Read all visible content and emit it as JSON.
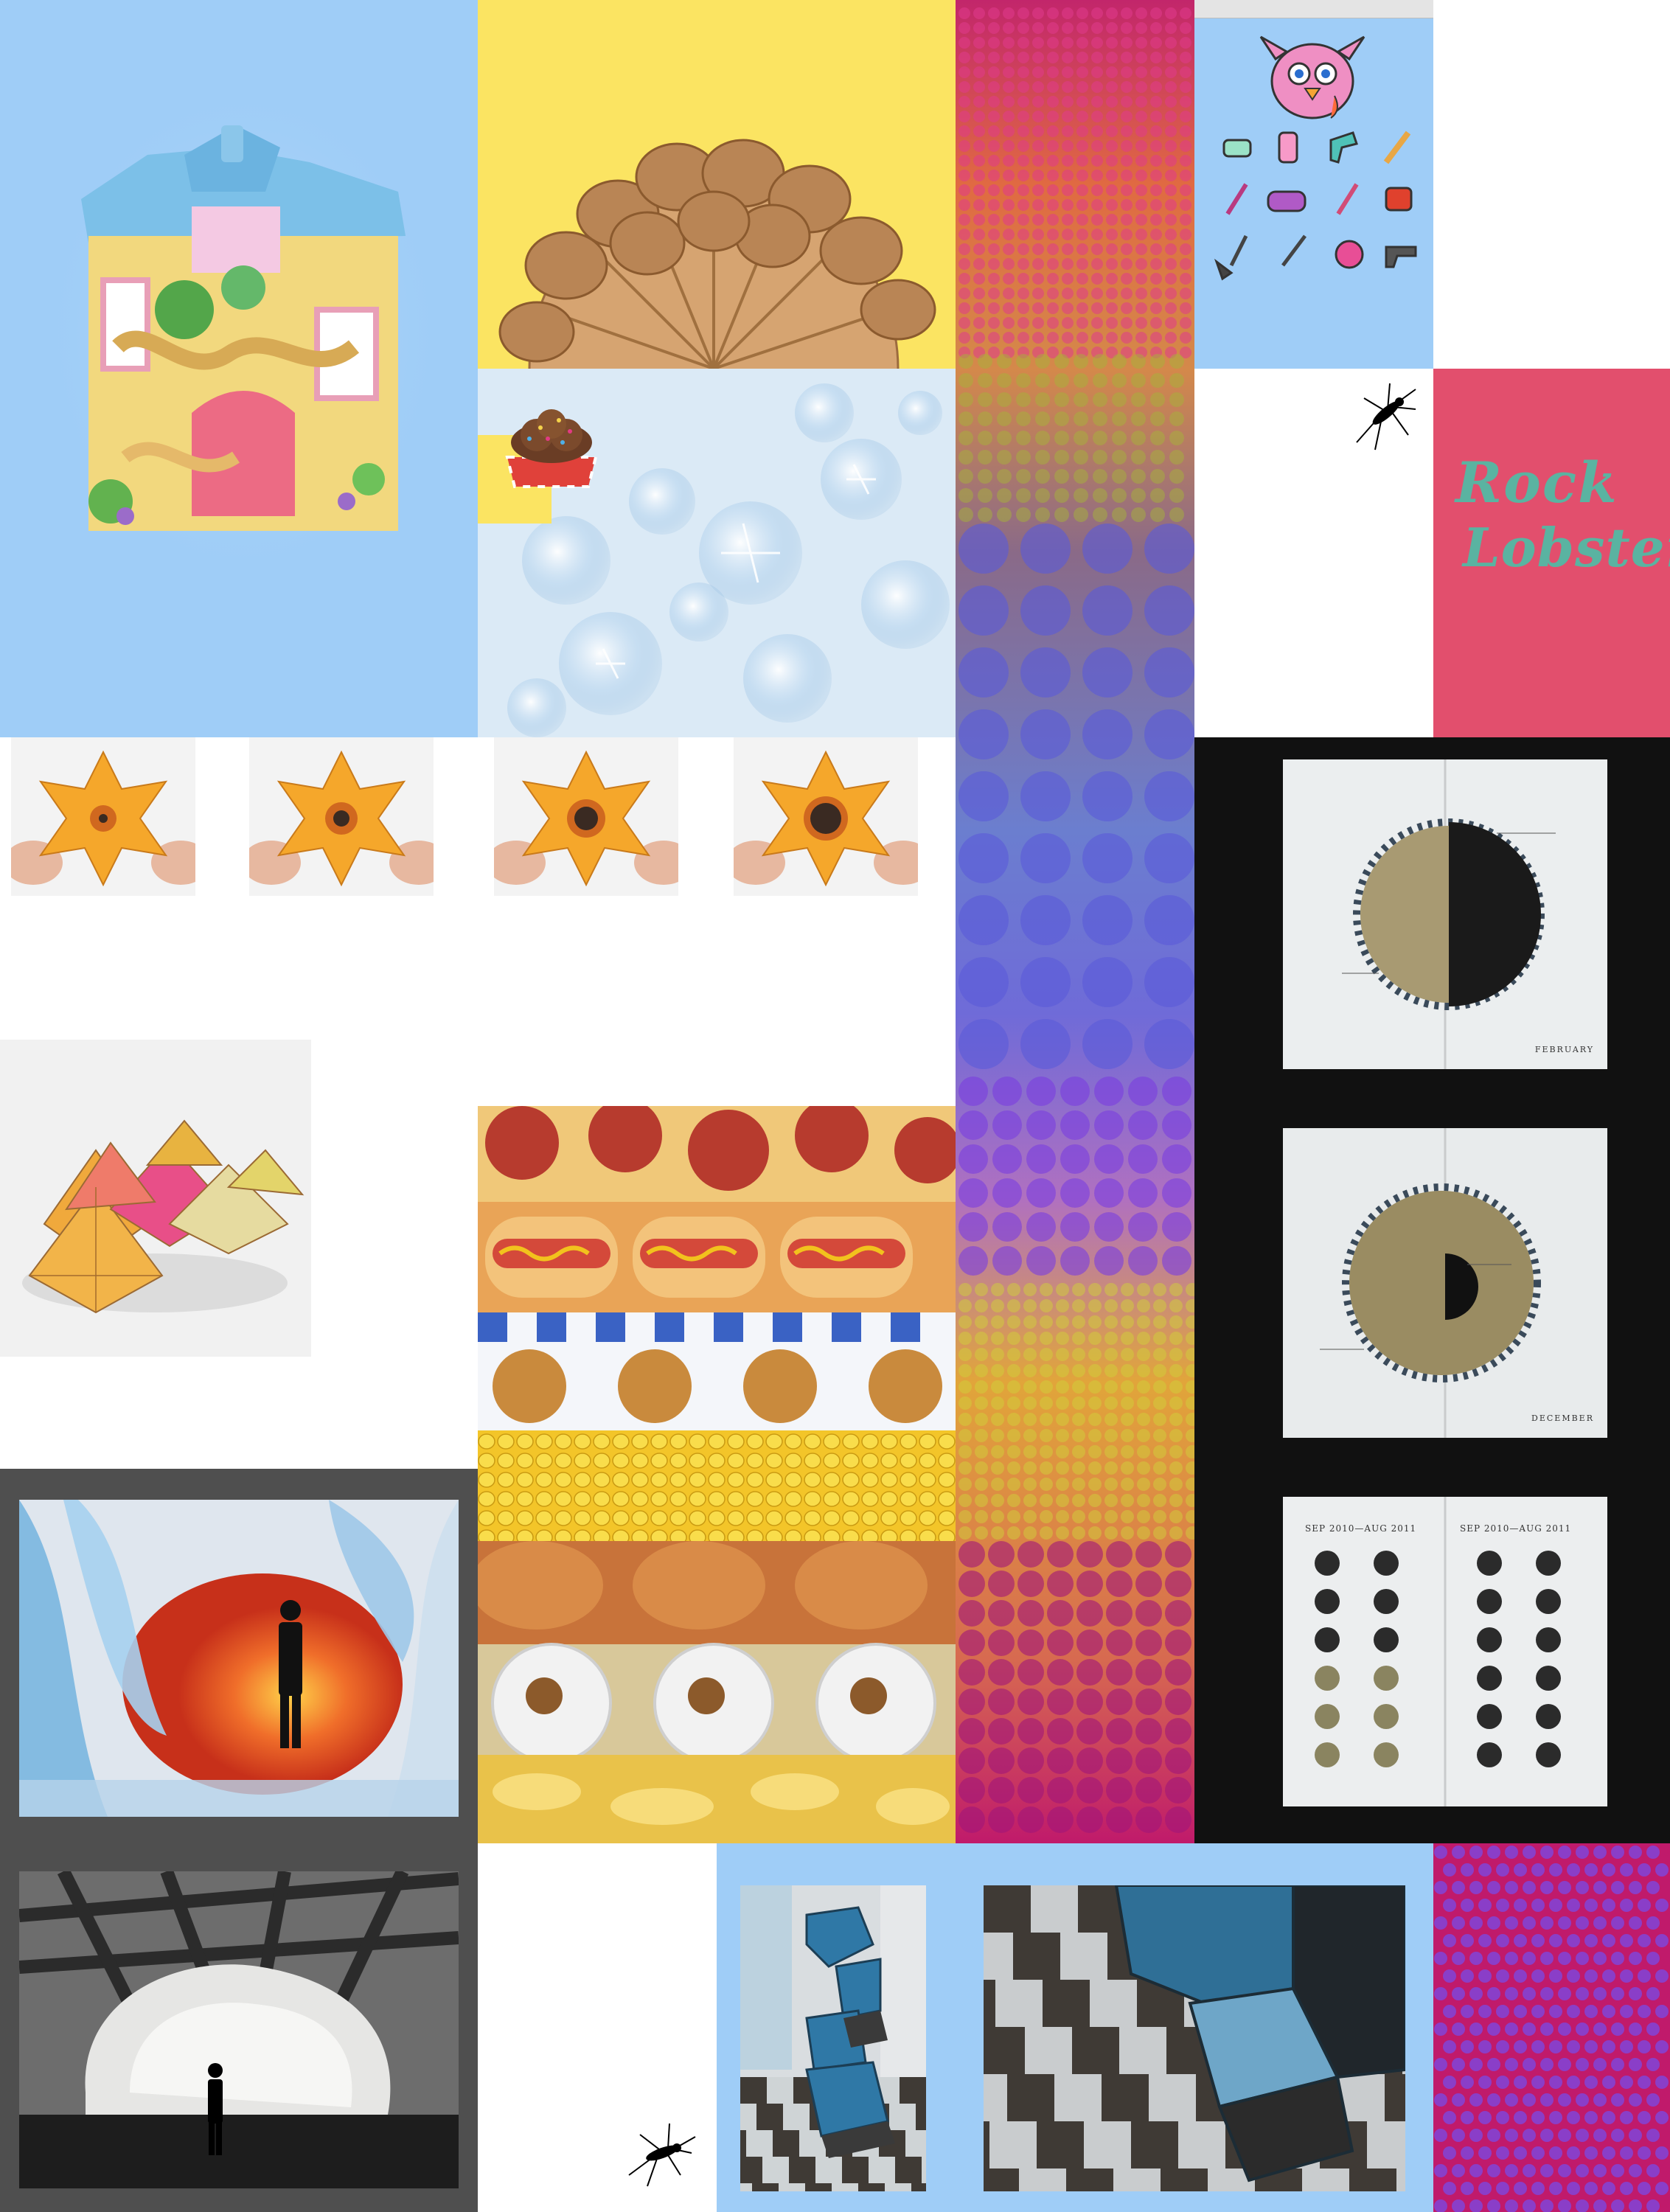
{
  "page": {
    "background": "#ffffff"
  },
  "tiles": {
    "dollhouse": {
      "background": "#9fcdf7",
      "icon": "dollhouse-image"
    },
    "cone_wheel": {
      "background": "#fbe462",
      "icon": "ice-cream-cone-wheel-image"
    },
    "sparkle_sky": {
      "background": "#cfe4f4",
      "icon": "sparkle-bokeh-image"
    },
    "sundae_tray": {
      "icon": "ice-cream-sundae-tray-image"
    },
    "dot_stripe": {
      "icon": "polka-dot-gradient-stripe"
    },
    "furby_toys": {
      "background": "#9fcdf7",
      "icon": "furby-toy-icons-image"
    },
    "mosquito_top": {
      "icon": "mosquito-icon"
    },
    "rock_lobster": {
      "background": "#e24f6d",
      "text_color": "#5ab3a1",
      "line1": "Rock",
      "line2": "Lobster"
    },
    "origami_flowers": {
      "count": 4,
      "icon": "origami-flower-image"
    },
    "calendar_book_1": {
      "icon": "book-spread-image",
      "page_label": "FEBRUARY"
    },
    "calendar_book_2": {
      "icon": "book-spread-image",
      "page_label": "DECEMBER"
    },
    "calendar_book_3": {
      "icon": "book-grid-spread-image",
      "header_left": "SEP 2010—AUG 2011",
      "header_right": "SEP 2010—AUG 2011"
    },
    "origami_pile": {
      "icon": "origami-flower-pile-image"
    },
    "food_collage": {
      "icon": "fast-food-collage-image"
    },
    "blue_wave_scene": {
      "icon": "blue-wave-sculpture-image"
    },
    "cave_scene": {
      "icon": "paper-cave-image"
    },
    "mosquito_bottom": {
      "icon": "mosquito-icon"
    },
    "sculpture_photos": {
      "background": "#9fcdf7",
      "icon": "checkered-floor-sculpture-image"
    },
    "magenta_dots": {
      "background": "#c01a6b",
      "dot_color": "#8a3ec8",
      "icon": "magenta-dot-pattern"
    }
  }
}
